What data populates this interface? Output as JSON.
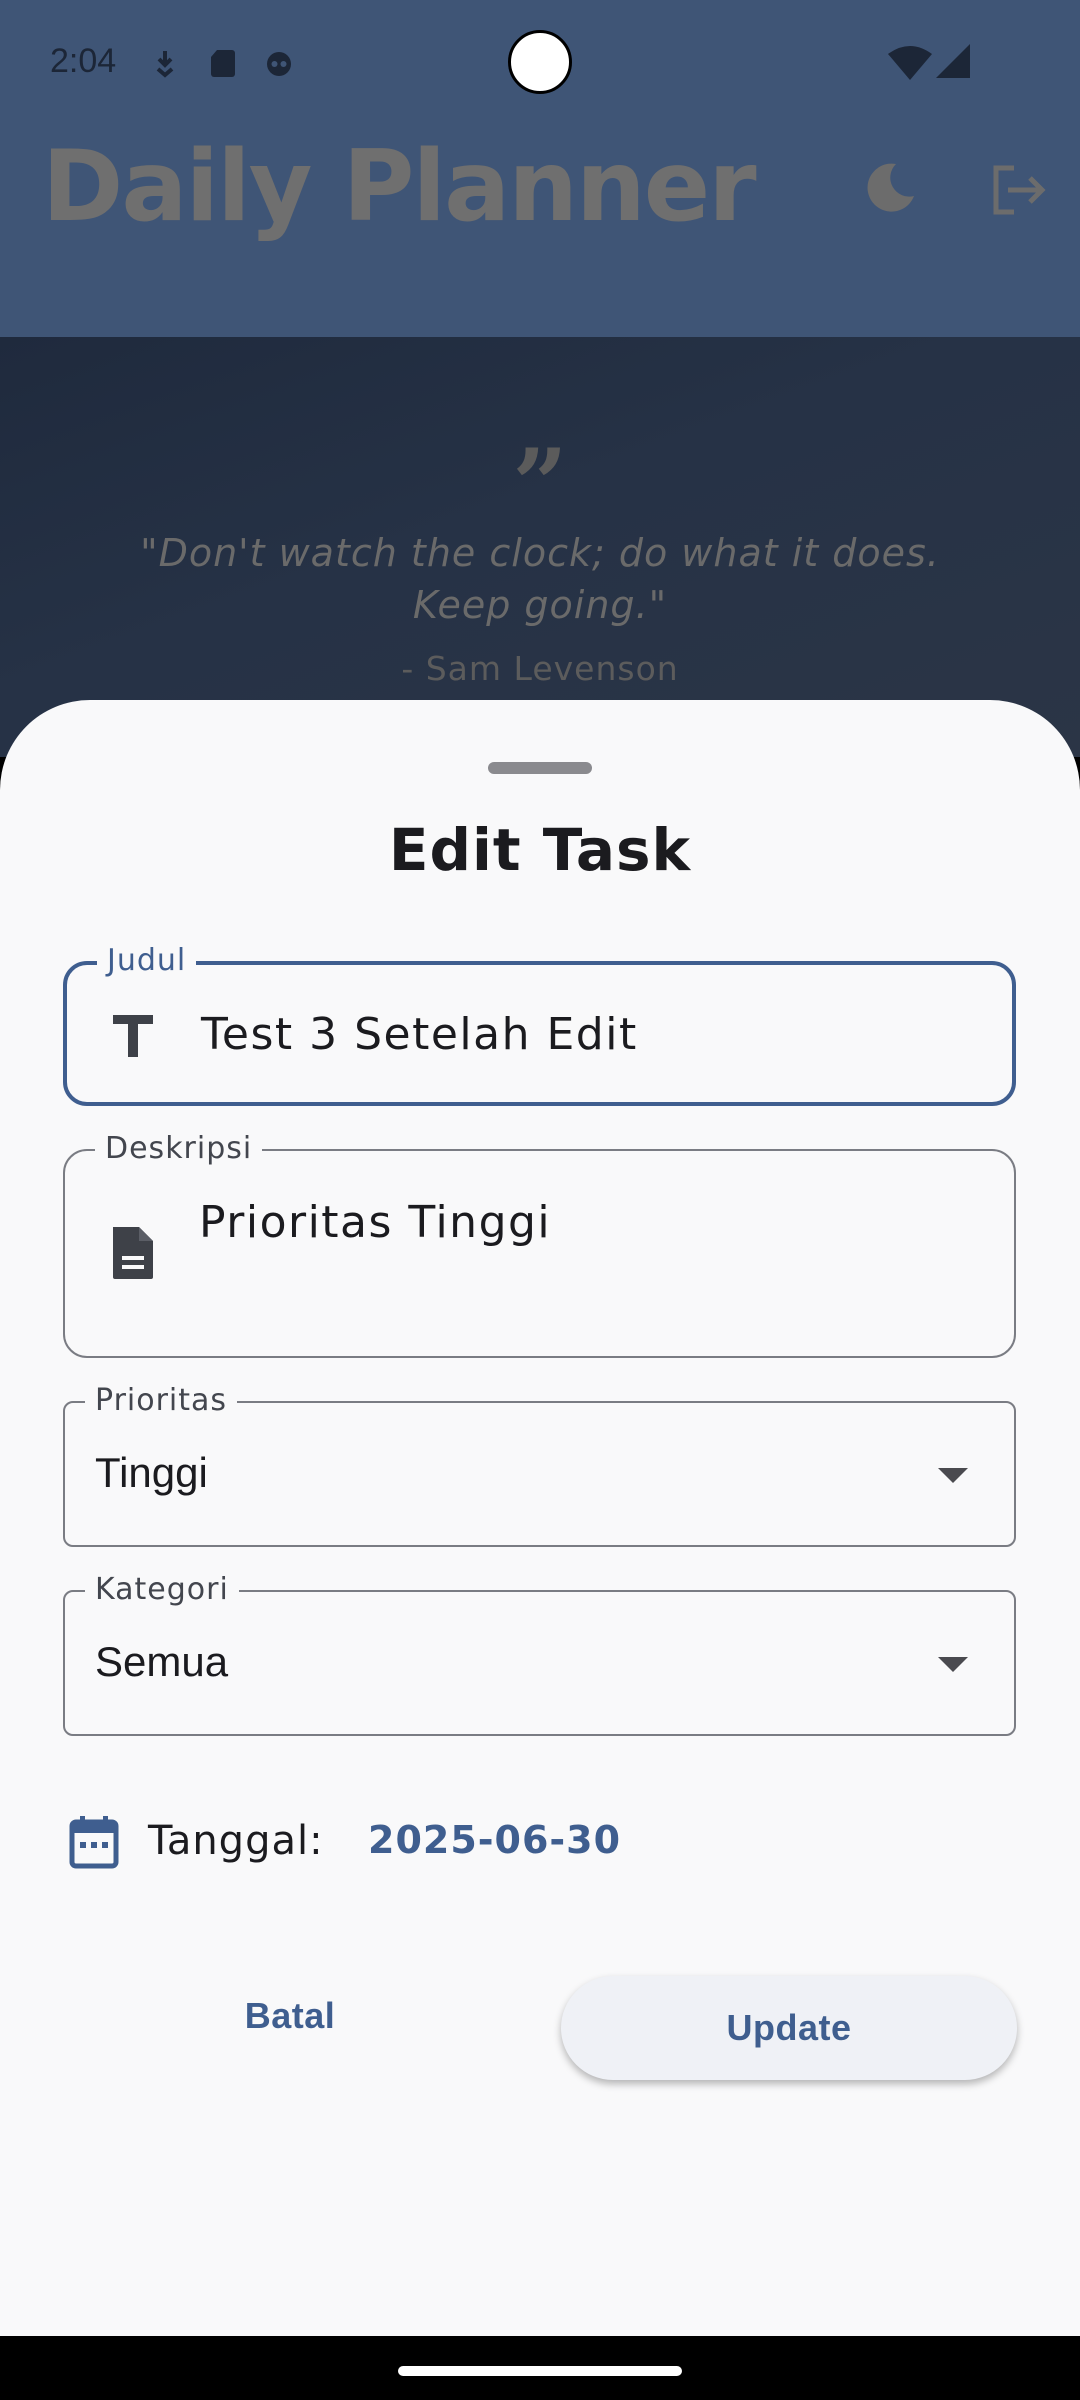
{
  "status_bar": {
    "time": "2:04"
  },
  "app": {
    "title": "Daily Planner",
    "quote": "\"Don't watch the clock; do what it does. Keep going.\"",
    "quote_author": "- Sam Levenson"
  },
  "sheet": {
    "title": "Edit Task",
    "title_field": {
      "label": "Judul",
      "value": "Test 3 Setelah Edit"
    },
    "description_field": {
      "label": "Deskripsi",
      "value": "Prioritas Tinggi"
    },
    "priority_field": {
      "label": "Prioritas",
      "value": "Tinggi"
    },
    "category_field": {
      "label": "Kategori",
      "value": "Semua"
    },
    "date": {
      "label": "Tanggal:",
      "value": "2025-06-30"
    },
    "cancel_label": "Batal",
    "update_label": "Update"
  },
  "colors": {
    "primary": "#3f5e8f",
    "app_bar": "#3f5576",
    "sheet_background": "#f9f9fa"
  }
}
